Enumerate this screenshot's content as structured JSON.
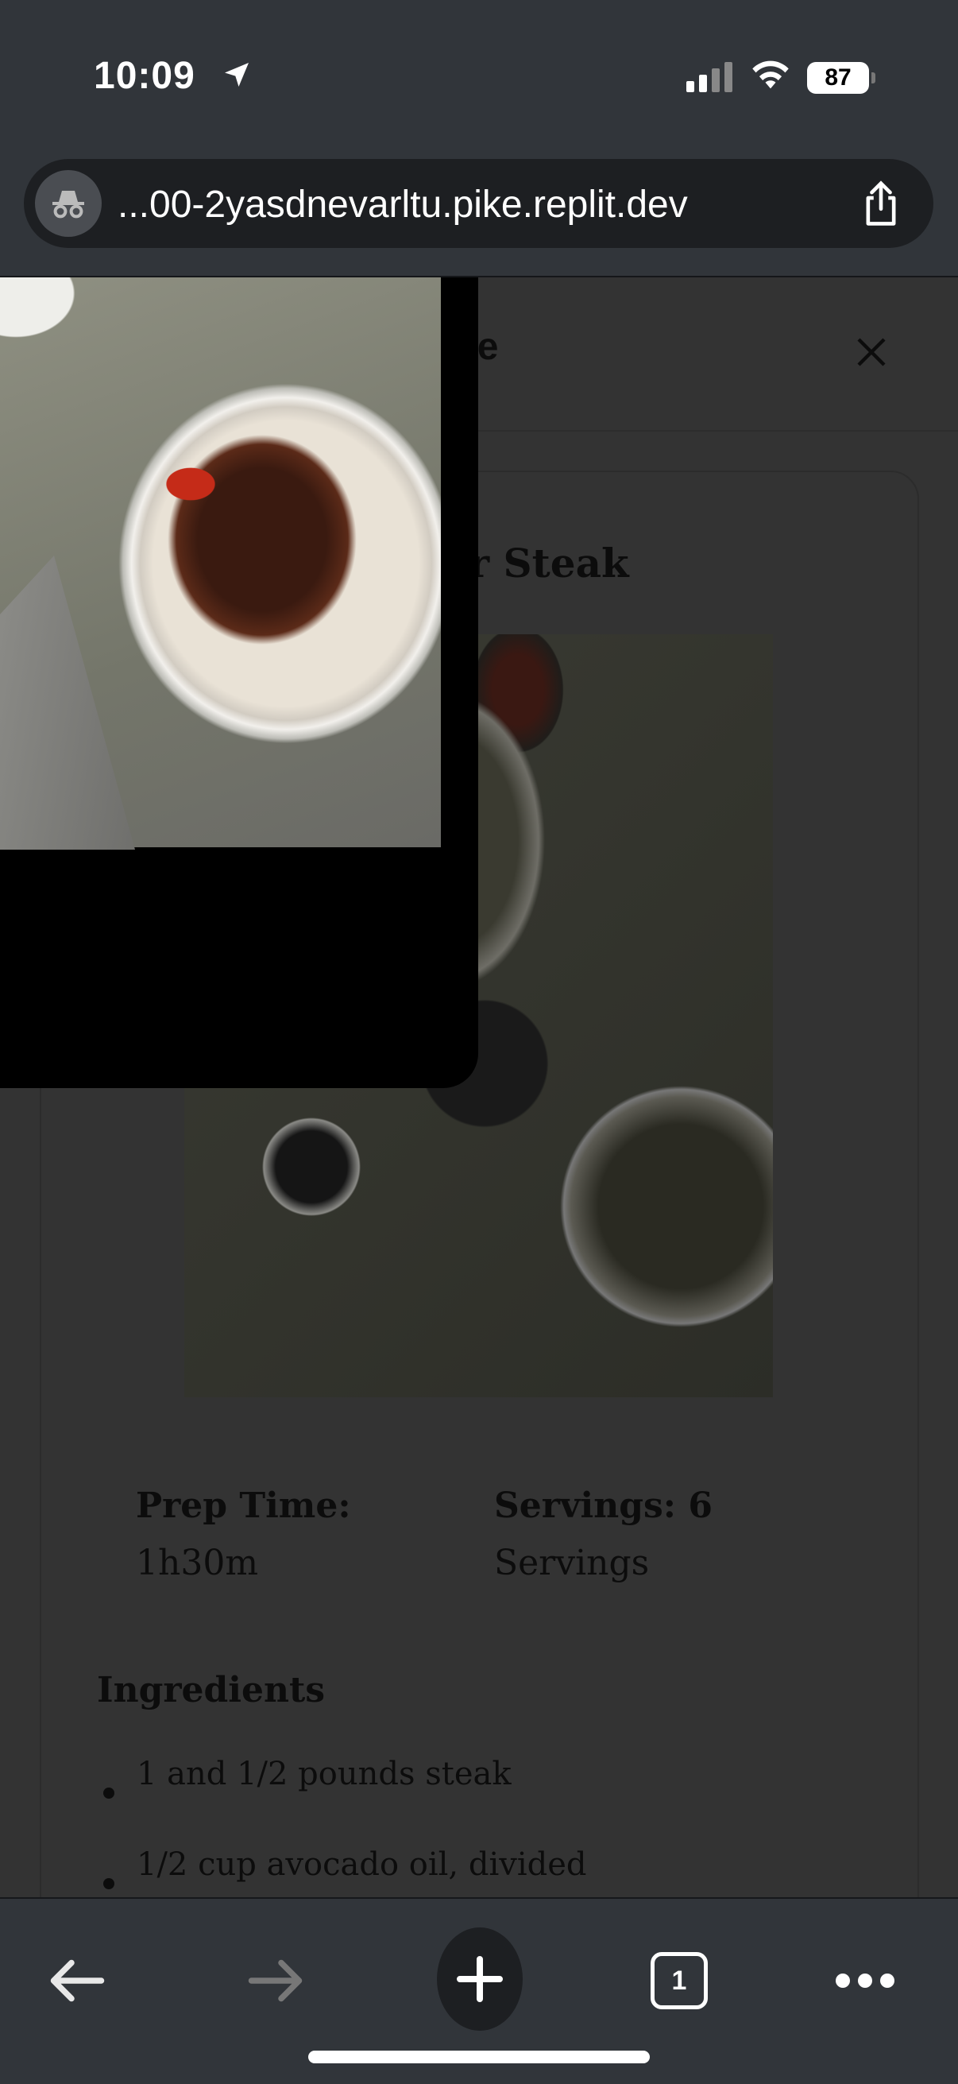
{
  "status_bar": {
    "time": "10:09",
    "battery": "87"
  },
  "browser": {
    "url": "...00-2yasdnevarltu.pike.replit.dev",
    "tab_count": "1"
  },
  "modal": {
    "title": "Recipe",
    "recipe_title": "Pepper Steak",
    "prep_time_label": "Prep Time:",
    "prep_time_value": "1h30m",
    "servings_label": "Servings: 6",
    "servings_value": "Servings",
    "ingredients_heading": "Ingredients",
    "ingredients": [
      "1 and 1/2 pounds steak",
      "1/2 cup avocado oil, divided"
    ]
  }
}
